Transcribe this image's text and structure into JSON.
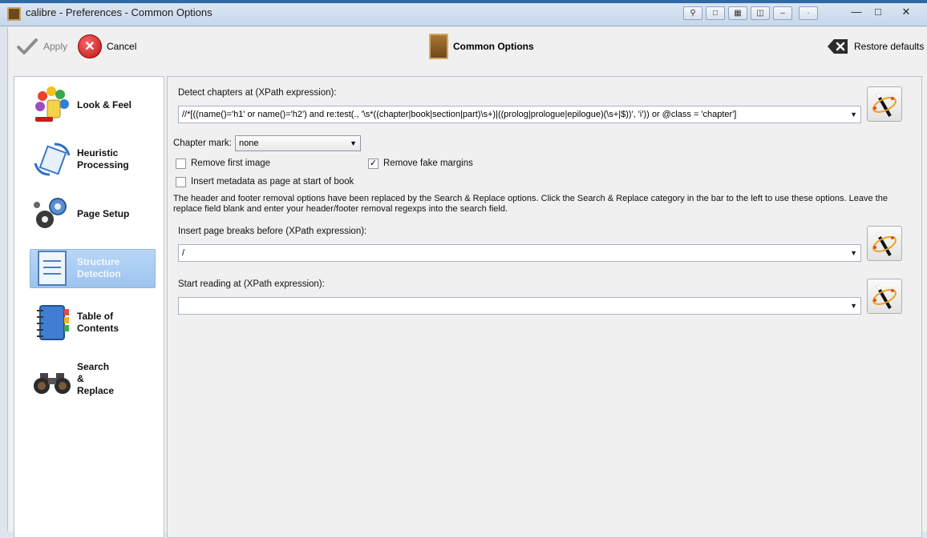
{
  "window": {
    "title": "calibre - Preferences - Common Options"
  },
  "toolbar": {
    "apply_label": "Apply",
    "cancel_label": "Cancel",
    "section_title": "Common Options",
    "restore_label": "Restore defaults"
  },
  "sidebar": {
    "items": [
      {
        "label": "Look & Feel",
        "icon": "palette-icon"
      },
      {
        "label": "Heuristic\nProcessing",
        "icon": "heuristic-icon"
      },
      {
        "label": "Page Setup",
        "icon": "gears-icon"
      },
      {
        "label": "Structure\nDetection",
        "icon": "structure-icon",
        "selected": true
      },
      {
        "label": "Table of\nContents",
        "icon": "toc-book-icon"
      },
      {
        "label": "Search\n&\nReplace",
        "icon": "binoculars-icon"
      }
    ]
  },
  "form": {
    "detect_chapters_label": "Detect chapters at (XPath expression):",
    "detect_chapters_value": "//*[((name()='h1' or name()='h2') and re:test(., '\\s*((chapter|book|section|part)\\s+)|((prolog|prologue|epilogue)(\\s+|$))', 'i')) or @class = 'chapter']",
    "chapter_mark_label": "Chapter mark:",
    "chapter_mark_value": "none",
    "remove_first_image_label": "Remove first image",
    "remove_first_image_checked": false,
    "remove_fake_margins_label": "Remove fake margins",
    "remove_fake_margins_checked": true,
    "insert_metadata_label": "Insert metadata as page at start of book",
    "insert_metadata_checked": false,
    "info_text": "The header and footer removal options have been replaced by the Search & Replace options. Click the Search & Replace category in the bar to the left to use these options. Leave the replace field blank and enter your header/footer removal regexps into the search field.",
    "page_breaks_label": "Insert page breaks before (XPath expression):",
    "page_breaks_value": "/",
    "start_reading_label": "Start reading at (XPath expression):",
    "start_reading_value": ""
  },
  "colors": {
    "selection": "#a8ccf2",
    "cancel_red": "#d01919"
  }
}
